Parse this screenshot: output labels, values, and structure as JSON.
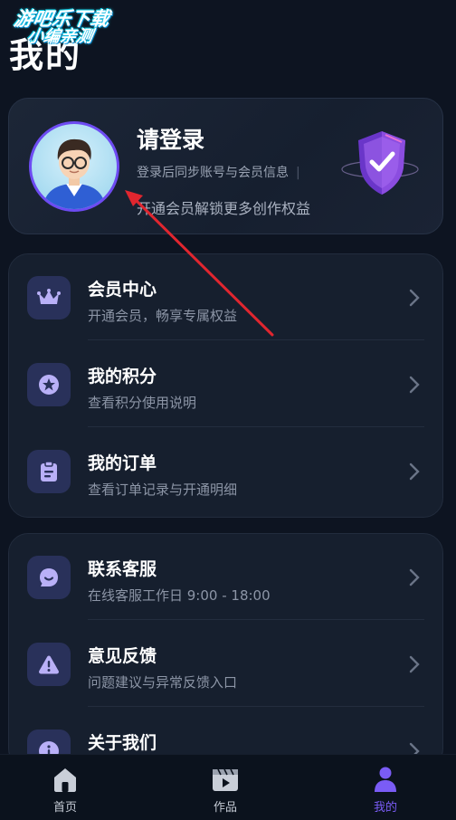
{
  "watermark": {
    "line1": "游吧乐下载",
    "line2": "小编亲测"
  },
  "page": {
    "title": "我的"
  },
  "login": {
    "title": "请登录",
    "subtitle": "登录后同步账号与会员信息",
    "separator": "|",
    "promo": "开通会员解锁更多创作权益"
  },
  "sections": [
    {
      "items": [
        {
          "icon": "crown-icon",
          "title": "会员中心",
          "desc": "开通会员，畅享专属权益"
        },
        {
          "icon": "star-icon",
          "title": "我的积分",
          "desc": "查看积分使用说明"
        },
        {
          "icon": "clipboard-icon",
          "title": "我的订单",
          "desc": "查看订单记录与开通明细"
        }
      ]
    },
    {
      "items": [
        {
          "icon": "chat-smile-icon",
          "title": "联系客服",
          "desc": "在线客服工作日 9:00 - 18:00"
        },
        {
          "icon": "warning-icon",
          "title": "意见反馈",
          "desc": "问题建议与异常反馈入口"
        },
        {
          "icon": "info-icon",
          "title": "关于我们",
          "desc": ""
        }
      ]
    }
  ],
  "tabs": [
    {
      "icon": "home-icon",
      "label": "首页",
      "active": false
    },
    {
      "icon": "video-icon",
      "label": "作品",
      "active": false
    },
    {
      "icon": "user-icon",
      "label": "我的",
      "active": true
    }
  ],
  "colors": {
    "background": "#0d1421",
    "card": "#161f2e",
    "accent": "#7a5cf5",
    "icon_tile": "#29315a",
    "annotation_arrow": "#e0262f"
  }
}
